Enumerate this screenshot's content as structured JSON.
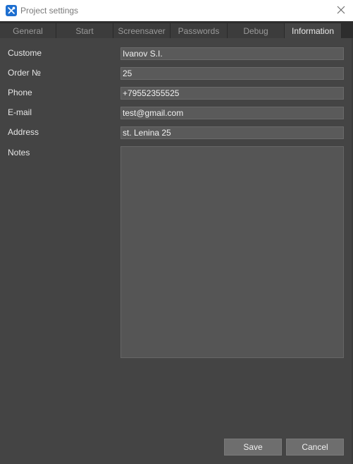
{
  "window": {
    "title": "Project settings",
    "app_icon": "tools-icon",
    "close_icon": "close-icon"
  },
  "tabs": [
    {
      "label": "General",
      "active": false
    },
    {
      "label": "Start",
      "active": false
    },
    {
      "label": "Screensaver",
      "active": false
    },
    {
      "label": "Passwords",
      "active": false
    },
    {
      "label": "Debug",
      "active": false
    },
    {
      "label": "Information",
      "active": true
    }
  ],
  "form": {
    "customer": {
      "label": "Custome",
      "value": "Ivanov S.I."
    },
    "order": {
      "label": "Order №",
      "value": "25"
    },
    "phone": {
      "label": "Phone",
      "value": "+79552355525"
    },
    "email": {
      "label": "E-mail",
      "value": "test@gmail.com"
    },
    "address": {
      "label": "Address",
      "value": "st. Lenina 25"
    },
    "notes": {
      "label": "Notes",
      "value": ""
    }
  },
  "buttons": {
    "save_label": "Save",
    "cancel_label": "Cancel"
  },
  "colors": {
    "background": "#444444",
    "input_background": "#5a5a5a",
    "tabbar_background": "#2d2d2d",
    "button_background": "#6e6e6e",
    "app_icon_blue": "#1e6fd0"
  }
}
